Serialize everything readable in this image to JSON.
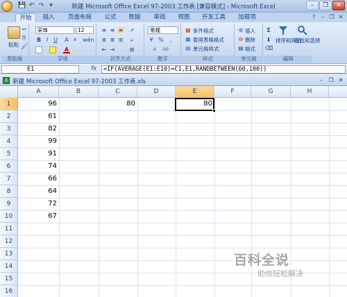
{
  "window": {
    "title": "新建 Microsoft Office Excel 97-2003 工作表 [兼容模式] - Microsoft Excel",
    "qat_icons": [
      "save-icon",
      "undo-icon",
      "redo-icon",
      "dropdown-icon"
    ],
    "controls": {
      "minimize": "–",
      "restore": "❐",
      "close": "✕"
    }
  },
  "ribbon": {
    "tabs": [
      {
        "label": "开始",
        "active": true
      },
      {
        "label": "插入",
        "active": false
      },
      {
        "label": "页面布局",
        "active": false
      },
      {
        "label": "公式",
        "active": false
      },
      {
        "label": "数据",
        "active": false
      },
      {
        "label": "审阅",
        "active": false
      },
      {
        "label": "视图",
        "active": false
      },
      {
        "label": "开发工具",
        "active": false
      },
      {
        "label": "加载项",
        "active": false
      }
    ],
    "groups": {
      "clipboard": {
        "label": "剪贴板",
        "paste": "粘贴"
      },
      "font": {
        "label": "字体",
        "font_name": "宋体",
        "font_size": "12",
        "bold": "B",
        "italic": "I",
        "underline": "U",
        "grow": "A",
        "shrink": "A",
        "font_color": "A",
        "wen": "wén"
      },
      "alignment": {
        "label": "对齐方式"
      },
      "number": {
        "label": "数字",
        "format": "常规",
        "percent": "%",
        "comma": ","
      },
      "styles": {
        "label": "样式",
        "conditional": "条件格式",
        "table": "套用表格格式",
        "cell_styles": "单元格样式"
      },
      "cells": {
        "label": "单元格",
        "insert": "插入",
        "delete": "删除",
        "format": "格式"
      },
      "editing": {
        "label": "编辑",
        "sum": "Σ",
        "sort_filter": "排序和筛选",
        "find_select": "查找和选择"
      }
    }
  },
  "formula_bar": {
    "name_box": "E1",
    "fx": "fx",
    "formula": "=IF(AVERAGE(E1:E10)=C1,E1,RANDBETWEEN(60,100))"
  },
  "workbook": {
    "title": "新建 Microsoft Office Excel 97-2003 工作表.xls"
  },
  "sheet": {
    "columns": [
      "A",
      "B",
      "C",
      "D",
      "E",
      "F",
      "G",
      "H"
    ],
    "selected_column": "E",
    "rows": [
      "1",
      "2",
      "3",
      "4",
      "5",
      "6",
      "7",
      "8",
      "9",
      "10",
      "11",
      "12",
      "13",
      "14",
      "15",
      "16"
    ],
    "selected_row": "1",
    "cells": {
      "A1": "96",
      "A2": "61",
      "A3": "82",
      "A4": "99",
      "A5": "91",
      "A6": "74",
      "A7": "66",
      "A8": "64",
      "A9": "72",
      "A10": "67",
      "C1": "80",
      "E1": "80"
    }
  },
  "watermark": {
    "title": "百科全说",
    "subtitle": "助你轻松解决"
  }
}
